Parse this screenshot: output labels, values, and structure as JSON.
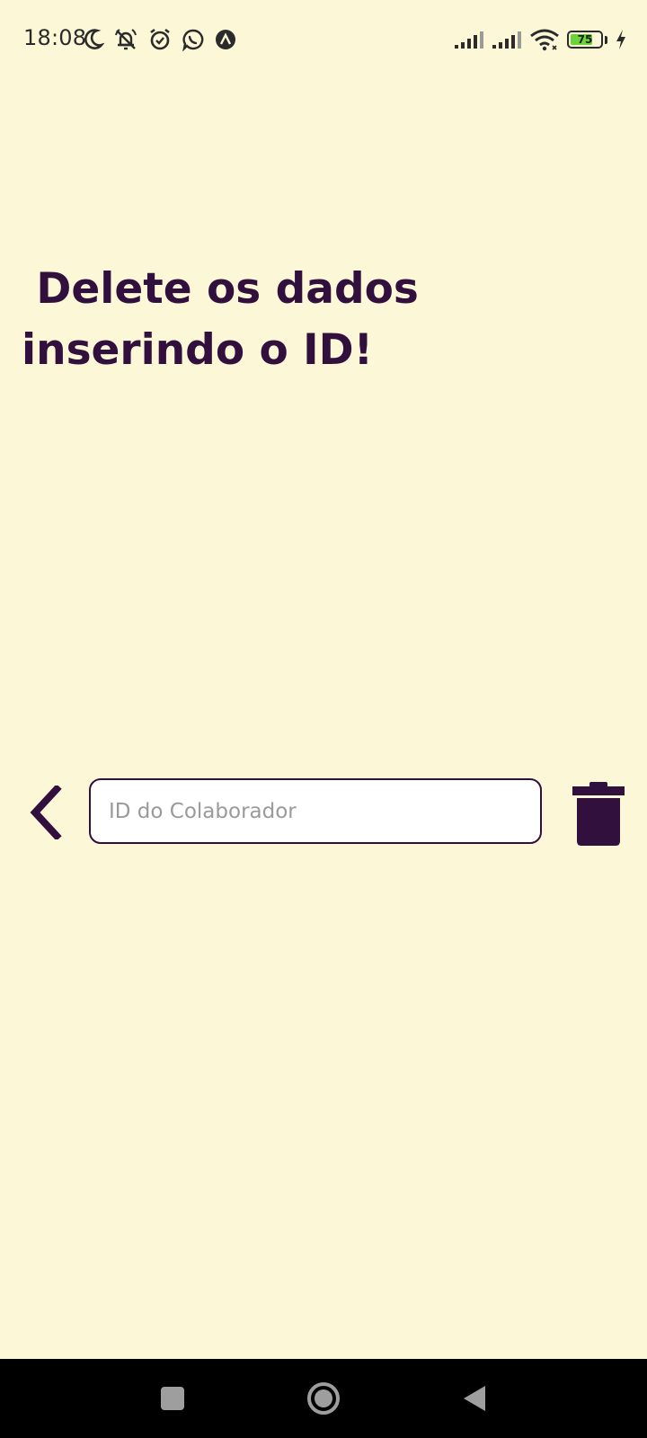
{
  "status_bar": {
    "time": "18:08",
    "battery_level": 75,
    "battery_label": "75",
    "left_icons": [
      "moon-icon",
      "notifications-off-icon",
      "alarm-icon",
      "whatsapp-icon",
      "app-icon"
    ],
    "right_icons": [
      "signal-icon",
      "signal-icon",
      "wifi-icon",
      "battery-icon",
      "charging-icon"
    ]
  },
  "page": {
    "title": " Delete os dados inserindo o ID!"
  },
  "form": {
    "id_input_placeholder": "ID do Colaborador",
    "id_input_value": ""
  },
  "colors": {
    "background": "#FCF8D7",
    "primary": "#32103E",
    "battery_fill": "#6bd23a"
  },
  "icons": {
    "back": "chevron-left-icon",
    "delete": "trash-icon"
  },
  "nav_bar": {
    "buttons": [
      "recents-button",
      "home-button",
      "back-button"
    ]
  }
}
